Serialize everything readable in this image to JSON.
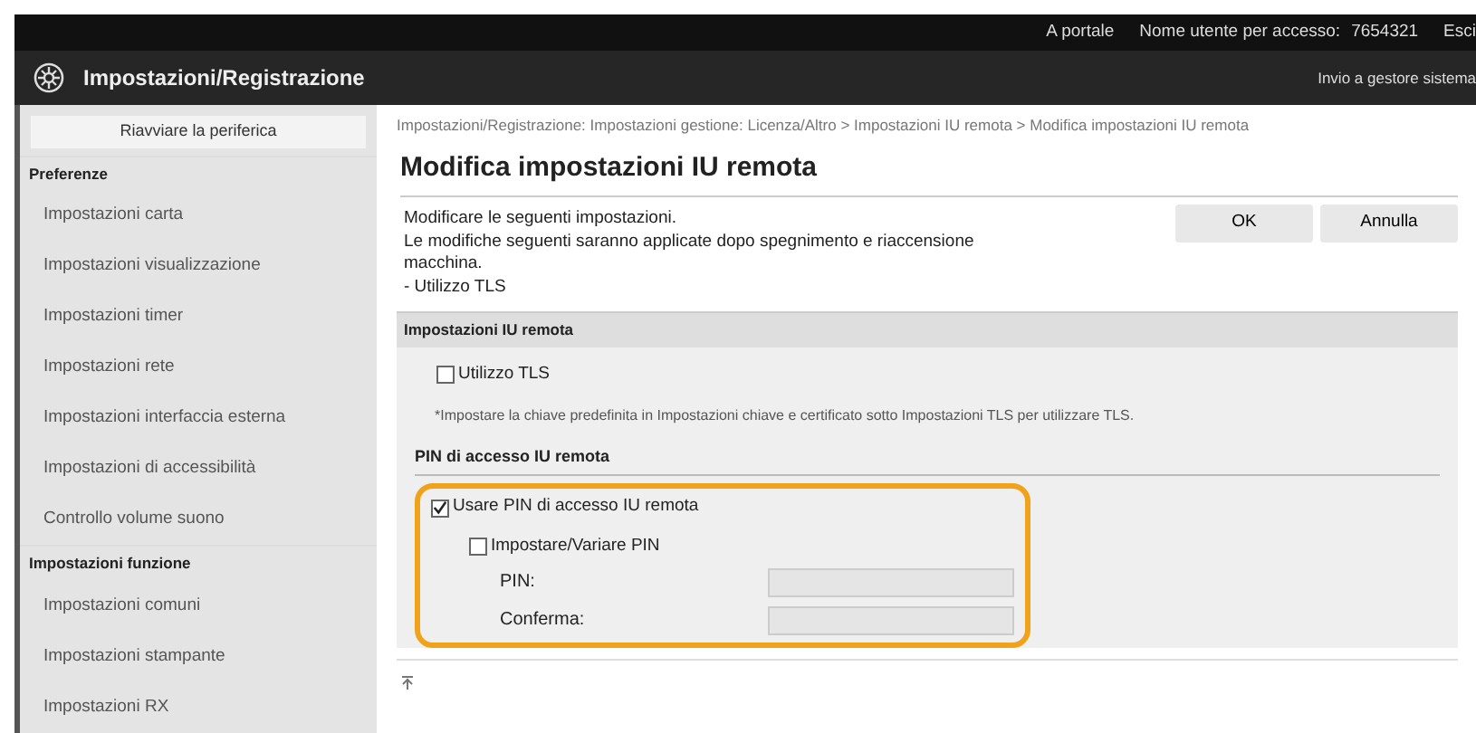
{
  "top_bar": {
    "portal_link": "A portale",
    "user_label": "Nome utente per accesso:",
    "user_id": "7654321",
    "logout": "Esci"
  },
  "header": {
    "title": "Impostazioni/Registrazione",
    "link": "Invio a gestore sistema"
  },
  "sidebar": {
    "restart_button": "Riavviare la periferica",
    "sections": [
      {
        "title": "Preferenze",
        "items": [
          "Impostazioni carta",
          "Impostazioni visualizzazione",
          "Impostazioni timer",
          "Impostazioni rete",
          "Impostazioni interfaccia esterna",
          "Impostazioni di accessibilità",
          "Controllo volume suono"
        ]
      },
      {
        "title": "Impostazioni funzione",
        "items": [
          "Impostazioni comuni",
          "Impostazioni stampante",
          "Impostazioni RX"
        ]
      }
    ]
  },
  "main": {
    "breadcrumb": "Impostazioni/Registrazione: Impostazioni gestione: Licenza/Altro > Impostazioni IU remota > Modifica impostazioni IU remota",
    "title": "Modifica impostazioni IU remota",
    "description": [
      "Modificare le seguenti impostazioni.",
      "Le modifiche seguenti saranno applicate dopo spegnimento e riaccensione macchina.",
      "- Utilizzo TLS"
    ],
    "buttons": [
      "OK",
      "Annulla"
    ],
    "section": {
      "title": "Impostazioni IU remota",
      "tls": {
        "label": "Utilizzo TLS",
        "checked": false
      },
      "note": "*Impostare la chiave predefinita in Impostazioni chiave e certificato sotto Impostazioni TLS per utilizzare TLS.",
      "pin_group": {
        "title": "PIN di accesso IU remota",
        "use_pin": {
          "label": "Usare PIN di accesso IU remota",
          "checked": true
        },
        "set_pin": {
          "label": "Impostare/Variare PIN",
          "checked": false
        },
        "fields": [
          {
            "label": "PIN:",
            "disabled": true
          },
          {
            "label": "Conferma:",
            "disabled": true
          }
        ]
      }
    }
  }
}
